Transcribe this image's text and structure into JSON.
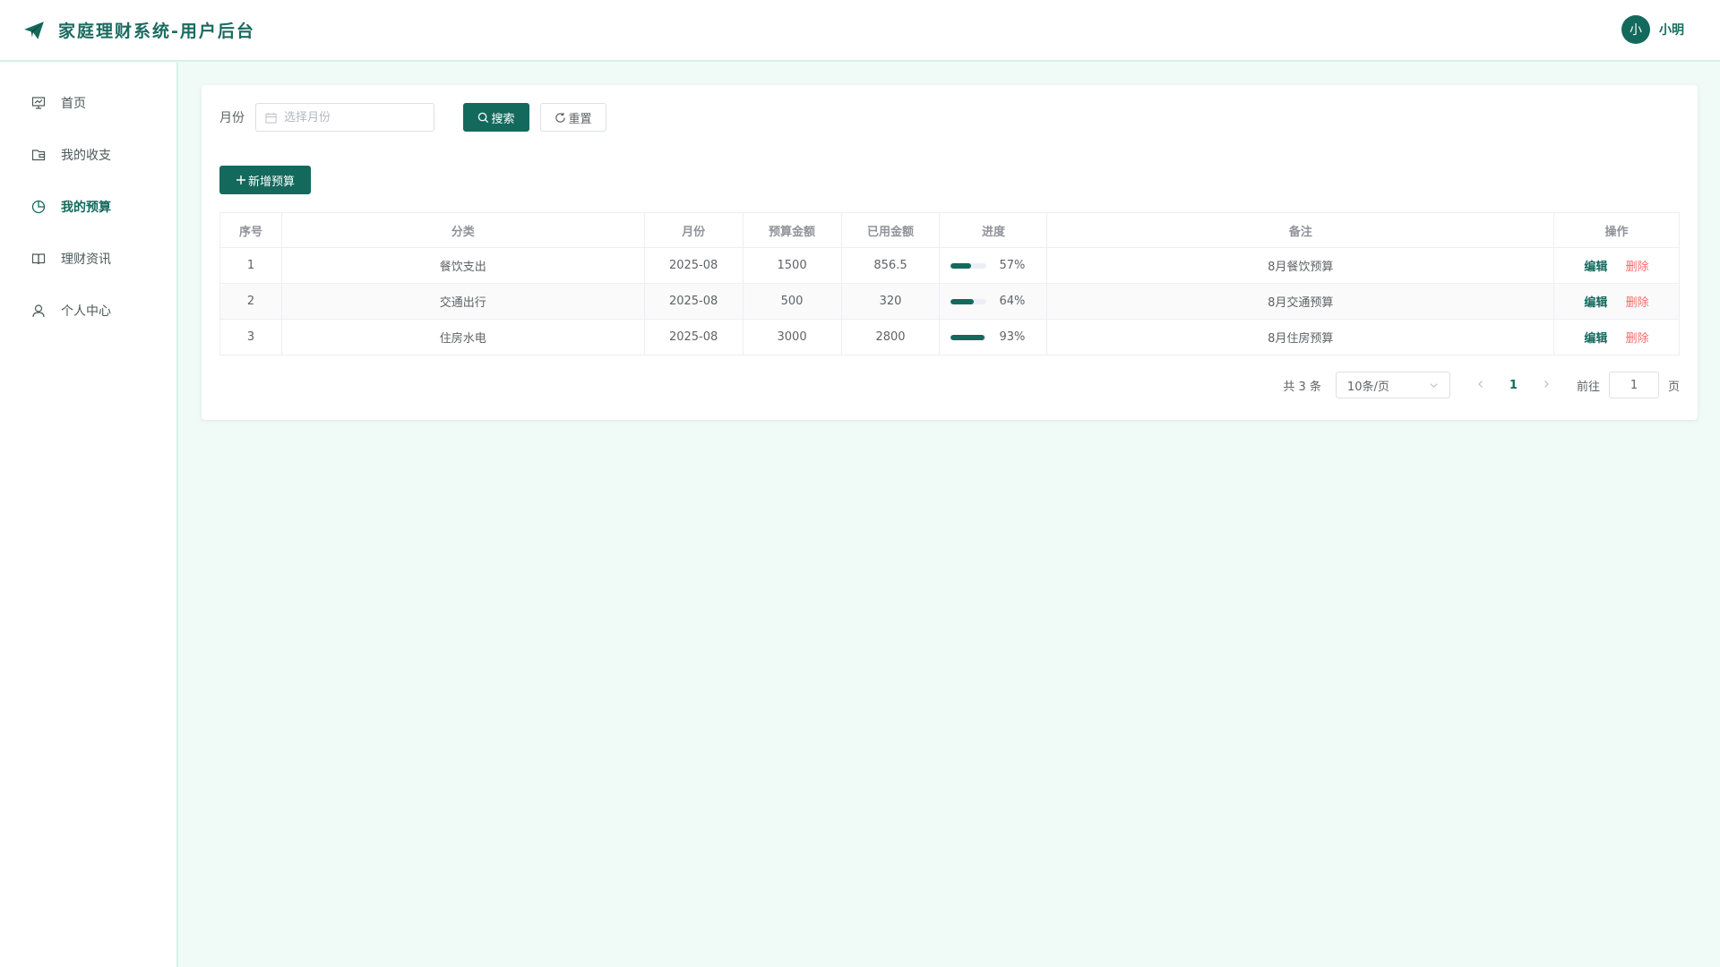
{
  "header": {
    "title": "家庭理财系统-用户后台",
    "logo_icon": "paper-plane-icon"
  },
  "user": {
    "avatar_char": "小",
    "name": "小明"
  },
  "sidebar": {
    "items": [
      {
        "label": "首页",
        "icon": "presentation-icon",
        "active": false
      },
      {
        "label": "我的收支",
        "icon": "wallet-icon",
        "active": false
      },
      {
        "label": "我的预算",
        "icon": "pie-chart-icon",
        "active": true
      },
      {
        "label": "理财资讯",
        "icon": "book-icon",
        "active": false
      },
      {
        "label": "个人中心",
        "icon": "user-icon",
        "active": false
      }
    ]
  },
  "search": {
    "month_label": "月份",
    "month_placeholder": "选择月份",
    "search_label": "搜索",
    "reset_label": "重置"
  },
  "toolbar": {
    "add_label": "新增预算"
  },
  "table": {
    "headers": [
      "序号",
      "分类",
      "月份",
      "预算金额",
      "已用金额",
      "进度",
      "备注",
      "操作"
    ],
    "rows": [
      {
        "index": "1",
        "category": "餐饮支出",
        "month": "2025-08",
        "budget": "1500",
        "used": "856.5",
        "progress": 57,
        "progress_text": "57%",
        "note": "8月餐饮预算"
      },
      {
        "index": "2",
        "category": "交通出行",
        "month": "2025-08",
        "budget": "500",
        "used": "320",
        "progress": 64,
        "progress_text": "64%",
        "note": "8月交通预算"
      },
      {
        "index": "3",
        "category": "住房水电",
        "month": "2025-08",
        "budget": "3000",
        "used": "2800",
        "progress": 93,
        "progress_text": "93%",
        "note": "8月住房预算"
      }
    ],
    "edit_label": "编辑",
    "delete_label": "删除"
  },
  "pagination": {
    "total_text": "共 3 条",
    "page_size": "10条/页",
    "current_page": "1",
    "goto_label": "前往",
    "goto_value": "1",
    "page_suffix": "页"
  },
  "colors": {
    "primary": "#14695d",
    "danger": "#f56c6c",
    "background": "#f0fbf8"
  }
}
